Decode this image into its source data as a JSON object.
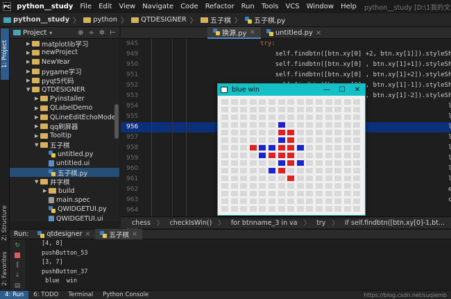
{
  "menubar": {
    "logo_text": "PC",
    "project_name": "python__study",
    "items": [
      "File",
      "Edit",
      "View",
      "Navigate",
      "Code",
      "Refactor",
      "Run",
      "Tools",
      "VCS",
      "Window",
      "Help"
    ],
    "window_title": "python__study [D:\\1我的文件夹\\python__study] - ...\\python\\QTDESIGNER\\五子棋\\五子棋"
  },
  "navbar": {
    "crumbs": [
      "python__study",
      "python",
      "QTDESIGNER",
      "五子棋",
      "五子棋.py"
    ]
  },
  "leftstrip": {
    "project_tab": "1: Project",
    "structure_tab": "Z: Structure",
    "favorites_tab": "2: Favorites"
  },
  "project_panel": {
    "title": "Project",
    "tools": [
      "⊕",
      "÷",
      "✲",
      "⊢"
    ],
    "tree": [
      {
        "label": "matplotlib学习",
        "kind": "folder",
        "depth": 1,
        "open": false
      },
      {
        "label": "newProject",
        "kind": "folder",
        "depth": 1,
        "open": false
      },
      {
        "label": "NewYear",
        "kind": "folder",
        "depth": 1,
        "open": false
      },
      {
        "label": "pygame学习",
        "kind": "folder",
        "depth": 1,
        "open": false
      },
      {
        "label": "pyqt5代码",
        "kind": "folder",
        "depth": 1,
        "open": false
      },
      {
        "label": "QTDESIGNER",
        "kind": "folder",
        "depth": 1,
        "open": true
      },
      {
        "label": "Pyinstaller",
        "kind": "folder",
        "depth": 2,
        "open": false
      },
      {
        "label": "QLabelDemo",
        "kind": "folder",
        "depth": 2,
        "open": false
      },
      {
        "label": "QLineEditEchoMode",
        "kind": "folder",
        "depth": 2,
        "open": false
      },
      {
        "label": "qq刷屏器",
        "kind": "folder",
        "depth": 2,
        "open": false
      },
      {
        "label": "Tooltip",
        "kind": "folder",
        "depth": 2,
        "open": false
      },
      {
        "label": "五子棋",
        "kind": "folder",
        "depth": 2,
        "open": true
      },
      {
        "label": "untitled.py",
        "kind": "py",
        "depth": 3
      },
      {
        "label": "untitled.ui",
        "kind": "ui",
        "depth": 3
      },
      {
        "label": "五子棋.py",
        "kind": "py",
        "depth": 3,
        "selected": true
      },
      {
        "label": "井字棋",
        "kind": "folder",
        "depth": 2,
        "open": true
      },
      {
        "label": "build",
        "kind": "folder",
        "depth": 3,
        "open": false
      },
      {
        "label": "main.spec",
        "kind": "file",
        "depth": 3
      },
      {
        "label": "QWIDGETUI.py",
        "kind": "py",
        "depth": 3
      },
      {
        "label": "QWIDGETUI.ui",
        "kind": "ui",
        "depth": 3
      },
      {
        "label": "井字棋.py",
        "kind": "py",
        "depth": 3
      }
    ]
  },
  "editor": {
    "tabs": [
      {
        "label": "换源.py",
        "active": true
      },
      {
        "label": "untitled.py",
        "active": false
      }
    ],
    "lines": [
      {
        "num": "945",
        "code": "            try:",
        "kind": "kw"
      },
      {
        "num": "949",
        "code": "                self.findbtn([btn.xy[0] +2, btn.xy[1]]).styleSheet()!='or\\"
      },
      {
        "num": "950",
        "code": "                self.findbtn([btn.xy[0] , btn.xy[1]+1]).styleSheet() == \\"
      },
      {
        "num": "951",
        "code": "                self.findbtn([btn.xy[0] , btn.xy[1]+2]).styleSheet() == \\"
      },
      {
        "num": "952",
        "code": "                self.findbtn([btn.xy[0] , btn.xy[1]-1]).styleSheet() == \\"
      },
      {
        "num": "953",
        "code": "                self.findbtn([btn.xy[0] , btn.xy[1]-2]).styleSheet() != '' or \\"
      },
      {
        "num": "954",
        "code": "                self.                                         leSheet() == \\"
      },
      {
        "num": "955",
        "code": "                self.                                         leSheet() == \\"
      },
      {
        "num": "956",
        "code": "                self.                                         leSheet() == \\",
        "highlight": true
      },
      {
        "num": "957",
        "code": "                self.                                         leSheet() != '' or \\"
      },
      {
        "num": "958",
        "code": "                self.                                         leSheet() == \\"
      },
      {
        "num": "959",
        "code": "                self.                                         leSheet() == \\"
      },
      {
        "num": "960",
        "code": "                self.                                         leSheet() == \\"
      },
      {
        "num": "961",
        "code": "                self.                                         leSheet() != '':"
      },
      {
        "num": "962",
        "code": "                                                              eSheet().replace('background"
      },
      {
        "num": "963",
        "code": "                self.                                         ce('background-color:','')"
      },
      {
        "num": "964",
        "code": ""
      },
      {
        "num": "965",
        "code": ""
      },
      {
        "num": "966",
        "code": ""
      },
      {
        "num": "967",
        "code": "            except:",
        "kind": "kw"
      }
    ]
  },
  "crumbbar": [
    "chess",
    "checkIsWin()",
    "for btnname_3 in va",
    "try",
    "if self.findbtn([btn.xy[0]-1,bt..."
  ],
  "run_panel": {
    "label": "Run:",
    "tabs": [
      {
        "label": "qtdesigner",
        "active": false
      },
      {
        "label": "五子棋",
        "active": true
      }
    ],
    "console": [
      "[4, 8]",
      "pushButton_53",
      "[3, 7]",
      "pushButton_37",
      " blue  win"
    ]
  },
  "statusbar": {
    "tabs": [
      {
        "label": "4: Run",
        "active": true
      },
      {
        "label": "6: TODO",
        "active": false
      },
      {
        "label": "Terminal",
        "active": false
      },
      {
        "label": "Python Console",
        "active": false
      }
    ],
    "watermark": "https://blog.csdn.net/suqiemb"
  },
  "popup": {
    "title": "blue  win",
    "min_label": "—",
    "max_label": "☐",
    "close_label": "✕",
    "grid_cols": 15,
    "grid_rows": 15,
    "red_stones": [
      [
        6,
        4
      ],
      [
        7,
        4
      ],
      [
        7,
        5
      ],
      [
        3,
        6
      ],
      [
        6,
        6
      ],
      [
        7,
        6
      ],
      [
        5,
        7
      ],
      [
        6,
        7
      ],
      [
        7,
        7
      ],
      [
        7,
        8
      ],
      [
        6,
        9
      ],
      [
        7,
        10
      ]
    ],
    "blue_stones": [
      [
        6,
        3
      ],
      [
        6,
        5
      ],
      [
        4,
        6
      ],
      [
        5,
        6
      ],
      [
        8,
        6
      ],
      [
        4,
        7
      ],
      [
        6,
        8
      ],
      [
        8,
        8
      ],
      [
        5,
        9
      ]
    ],
    "colors": {
      "red": "#dd2222",
      "blue": "#1b24cc",
      "empty": "#d9d9d9"
    }
  }
}
